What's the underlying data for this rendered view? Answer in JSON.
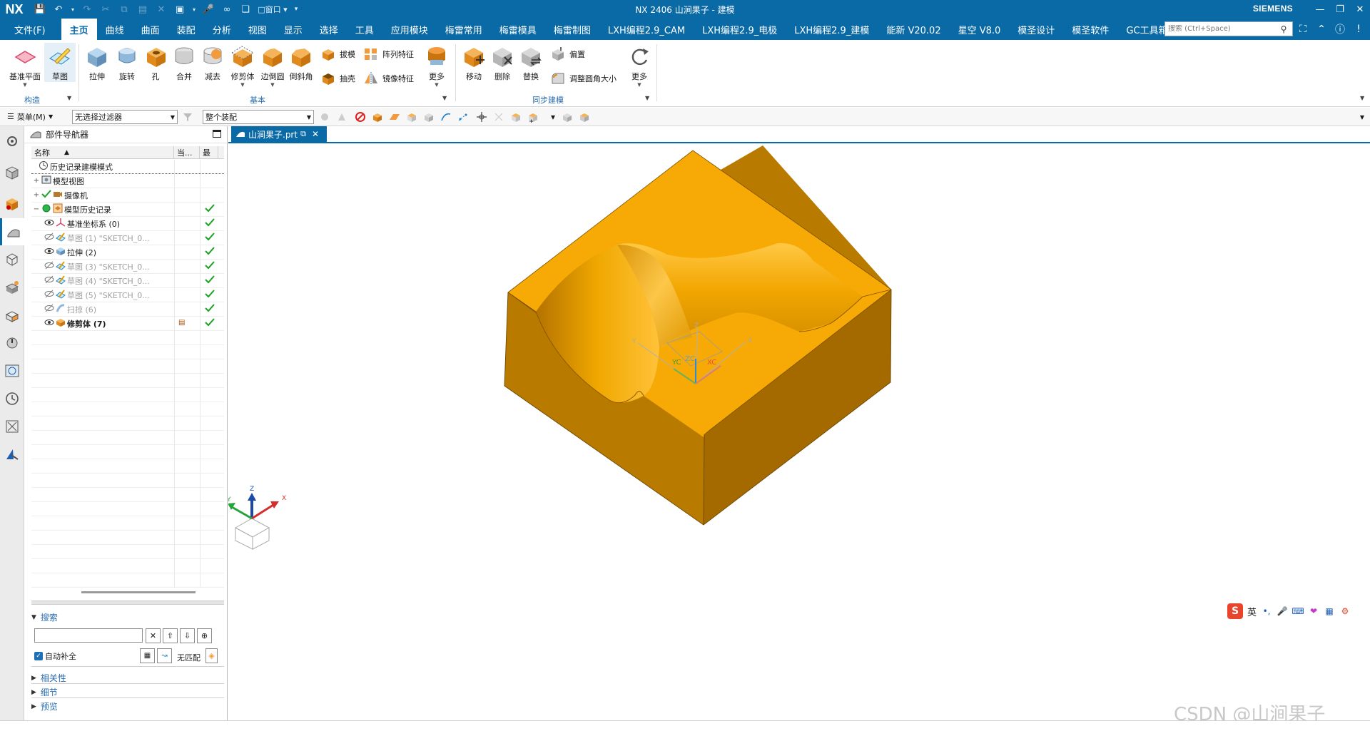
{
  "titlebar": {
    "logo": "NX",
    "title": "NX 2406  山涧果子 - 建模",
    "brand": "SIEMENS",
    "window_controls": [
      "minimize-icon",
      "restore-icon",
      "close-icon"
    ]
  },
  "menubar": {
    "file": "文件(F)",
    "items": [
      "主页",
      "曲线",
      "曲面",
      "装配",
      "分析",
      "视图",
      "显示",
      "选择",
      "工具",
      "应用模块",
      "梅雷常用",
      "梅雷模具",
      "梅雷制图",
      "LXH编程2.9_CAM",
      "LXH编程2.9_电极",
      "LXH编程2.9_建模",
      "能新 V20.02",
      "星空 V8.0",
      "模圣设计",
      "模圣软件",
      "GC工具箱"
    ],
    "active_index": 0,
    "search_placeholder": "搜索 (Ctrl+Space)"
  },
  "ribbon": {
    "groups": {
      "construct": "构造",
      "basic": "基本",
      "sync": "同步建模"
    },
    "buttons": {
      "datum_plane": "基准平面",
      "sketch": "草图",
      "extrude": "拉伸",
      "revolve": "旋转",
      "hole": "孔",
      "unite": "合并",
      "subtract": "减去",
      "trim_body": "修剪体",
      "edge_blend": "边倒圆",
      "chamfer": "倒斜角",
      "draft": "拔模",
      "pattern_feature": "阵列特征",
      "shell": "抽壳",
      "mirror_feature": "镜像特征",
      "more_basic": "更多",
      "move": "移动",
      "delete": "删除",
      "replace": "替换",
      "offset": "偏置",
      "resize_blend": "调整圆角大小",
      "more_sync": "更多"
    }
  },
  "selbar": {
    "menu": "菜单(M)",
    "filter": "无选择过滤器",
    "scope": "整个装配"
  },
  "navigator": {
    "title": "部件导航器",
    "columns": [
      "名称",
      "当...",
      "最"
    ],
    "rows": [
      {
        "label": "历史记录建模模式",
        "style": "normal",
        "icon": "clock-icon"
      },
      {
        "label": "模型视图",
        "style": "normal",
        "icon": "model-views-icon"
      },
      {
        "label": "摄像机",
        "style": "normal",
        "icon": "camera-icon"
      },
      {
        "label": "模型历史记录",
        "style": "normal",
        "icon": "history-icon"
      },
      {
        "label": "基准坐标系 (0)",
        "style": "normal",
        "icon": "datum-csys-icon"
      },
      {
        "label": "草图 (1) \"SKETCH_0...",
        "style": "grey",
        "icon": "sketch-icon"
      },
      {
        "label": "拉伸 (2)",
        "style": "normal",
        "icon": "extrude-icon"
      },
      {
        "label": "草图 (3) \"SKETCH_0...",
        "style": "grey",
        "icon": "sketch-icon"
      },
      {
        "label": "草图 (4) \"SKETCH_0...",
        "style": "grey",
        "icon": "sketch-icon"
      },
      {
        "label": "草图 (5) \"SKETCH_0...",
        "style": "grey",
        "icon": "sketch-icon"
      },
      {
        "label": "扫掠 (6)",
        "style": "grey",
        "icon": "swept-icon"
      },
      {
        "label": "修剪体 (7)",
        "style": "bold",
        "icon": "trim-body-icon"
      }
    ],
    "search": {
      "title": "搜索",
      "value": "",
      "auto_complete": "自动补全",
      "no_match": "无匹配"
    },
    "sections": [
      "相关性",
      "细节",
      "预览"
    ]
  },
  "tab": {
    "label": "山涧果子.prt"
  },
  "viewport": {
    "csys_labels": {
      "x": "XC",
      "y": "YC",
      "z": "ZC",
      "x_axis": "X",
      "y_axis": "Y",
      "z_axis": "Z"
    },
    "triad_labels": {
      "x": "X",
      "y": "Y",
      "z": "Z"
    },
    "ime": {
      "mode": "英"
    },
    "watermark": "CSDN @山涧果子"
  },
  "colors": {
    "accent": "#0a6aa6",
    "part_top": "#F7AA05",
    "part_front": "#B97A00",
    "part_right": "#A46A00",
    "check": "#1aa024"
  }
}
